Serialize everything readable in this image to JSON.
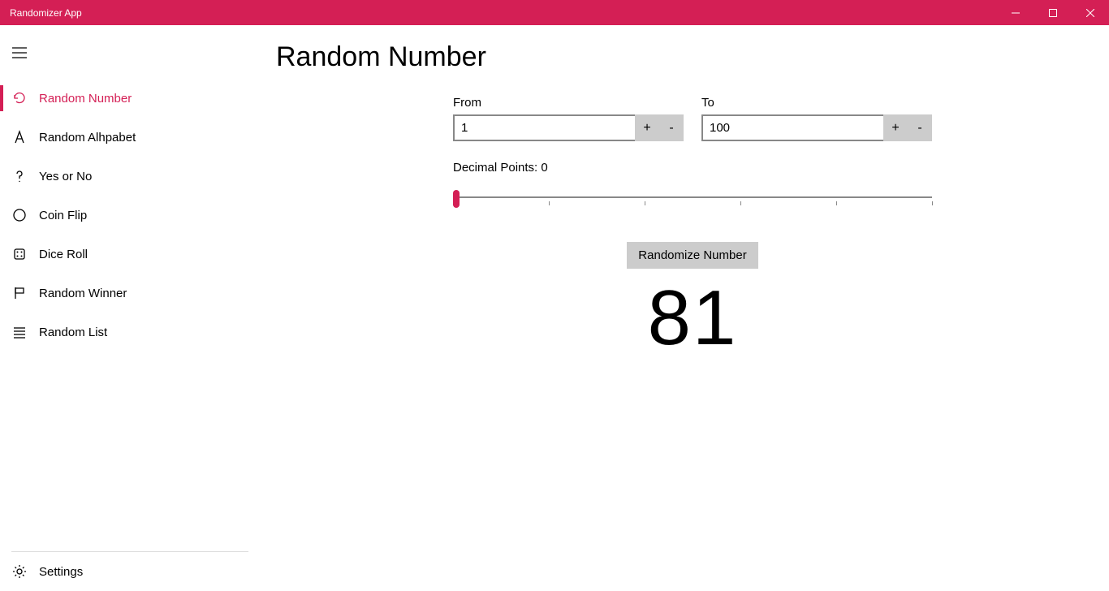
{
  "titlebar": {
    "title": "Randomizer App"
  },
  "sidebar": {
    "items": [
      {
        "label": "Random Number",
        "icon": "refresh-icon",
        "active": true
      },
      {
        "label": "Random Alhpabet",
        "icon": "letter-a-icon",
        "active": false
      },
      {
        "label": "Yes or No",
        "icon": "question-icon",
        "active": false
      },
      {
        "label": "Coin Flip",
        "icon": "circle-icon",
        "active": false
      },
      {
        "label": "Dice Roll",
        "icon": "dice-icon",
        "active": false
      },
      {
        "label": "Random Winner",
        "icon": "flag-icon",
        "active": false
      },
      {
        "label": "Random List",
        "icon": "list-icon",
        "active": false
      }
    ],
    "settings_label": "Settings"
  },
  "main": {
    "page_title": "Random Number",
    "from_label": "From",
    "to_label": "To",
    "from_value": "1",
    "to_value": "100",
    "plus": "+",
    "minus": "-",
    "decimal_label": "Decimal Points: 0",
    "randomize_label": "Randomize Number",
    "result": "81"
  },
  "colors": {
    "accent": "#d41f55"
  }
}
